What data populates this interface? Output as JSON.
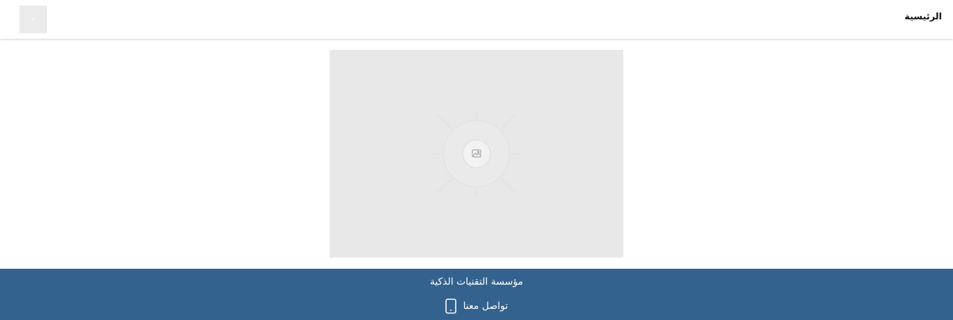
{
  "header": {
    "home_label": "الرئيسية",
    "logo_icon": "logo-placeholder-icon"
  },
  "main": {
    "image_icon": "image-placeholder-icon"
  },
  "footer": {
    "company_name": "مؤسسة التقنيات الذكية",
    "contact_label": "تواصل معنا",
    "contact_icon": "phone-icon"
  },
  "colors": {
    "footer_bg": "#34628e",
    "placeholder_bg": "#e8e8e8",
    "header_bg": "#ffffff"
  }
}
